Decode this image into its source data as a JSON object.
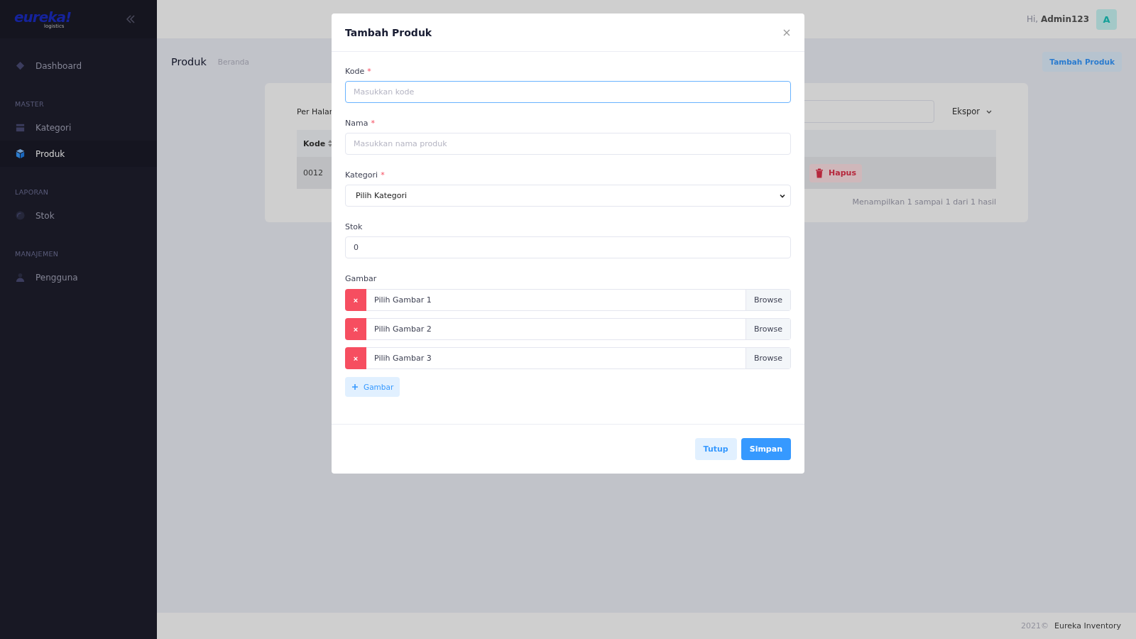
{
  "sidebar": {
    "logo": "eureka!",
    "logo_sub": "logistics",
    "nav": [
      {
        "kind": "link",
        "label": "Dashboard",
        "selected": false
      },
      {
        "kind": "heading",
        "label": "MASTER"
      },
      {
        "kind": "link",
        "label": "Kategori",
        "selected": false
      },
      {
        "kind": "link",
        "label": "Produk",
        "selected": true
      },
      {
        "kind": "heading",
        "label": "LAPORAN"
      },
      {
        "kind": "link",
        "label": "Stok",
        "selected": false
      },
      {
        "kind": "heading",
        "label": "MANAJEMEN"
      },
      {
        "kind": "link",
        "label": "Pengguna",
        "selected": false
      }
    ]
  },
  "topbar": {
    "greeting": "Hi,",
    "user": "Admin123",
    "avatar": "A"
  },
  "page": {
    "title": "Produk",
    "breadcrumb": "Beranda",
    "add_button": "Tambah Produk"
  },
  "card": {
    "per_page_label": "Per Halar",
    "export": "Ekspor",
    "columns": [
      "Kode"
    ],
    "rows": [
      {
        "code": "0012",
        "delete": "Hapus"
      }
    ],
    "summary": "Menampilkan 1 sampai 1 dari 1 hasil"
  },
  "footer": {
    "year": "2021©",
    "name": "Eureka Inventory"
  },
  "modal": {
    "title": "Tambah Produk",
    "fields": [
      {
        "kind": "text",
        "label": "Kode",
        "marker": "*",
        "placeholder": "Masukkan kode",
        "focused": true
      },
      {
        "kind": "text",
        "label": "Nama",
        "marker": "*",
        "placeholder": "Masukkan nama produk",
        "focused": false
      },
      {
        "kind": "select",
        "label": "Kategori",
        "marker": "*",
        "value": "Pilih Kategori",
        "focused": false
      },
      {
        "kind": "text",
        "label": "Stok",
        "value": "0",
        "focused": false
      }
    ],
    "images": {
      "label": "Gambar",
      "items": [
        {
          "remove": "×",
          "placeholder": "Pilih Gambar 1",
          "browse": "Browse"
        },
        {
          "remove": "×",
          "placeholder": "Pilih Gambar 2",
          "browse": "Browse"
        },
        {
          "remove": "×",
          "placeholder": "Pilih Gambar 3",
          "browse": "Browse"
        }
      ],
      "add": "Gambar"
    },
    "buttons": [
      {
        "kind": "secondary",
        "label": "Tutup"
      },
      {
        "kind": "primary",
        "label": "Simpan"
      }
    ]
  }
}
